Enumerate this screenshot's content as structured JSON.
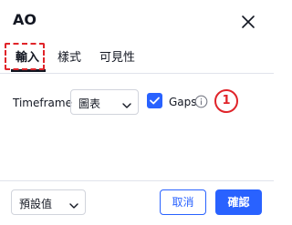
{
  "dialog": {
    "title": "AO",
    "close_icon": "close-icon"
  },
  "tabs": [
    {
      "label": "輸入",
      "active": true
    },
    {
      "label": "樣式",
      "active": false
    },
    {
      "label": "可見性",
      "active": false
    }
  ],
  "inputs": {
    "timeframe_label": "Timeframe",
    "timeframe_value": "圖表",
    "gaps_label": "Gaps",
    "gaps_checked": true
  },
  "annotation": {
    "badge_number": "1",
    "highlight_color": "#e0242a"
  },
  "footer": {
    "defaults_label": "預設值",
    "cancel_label": "取消",
    "ok_label": "確認"
  },
  "colors": {
    "accent": "#2962ff",
    "text": "#131722",
    "border": "#d1d4dc"
  }
}
